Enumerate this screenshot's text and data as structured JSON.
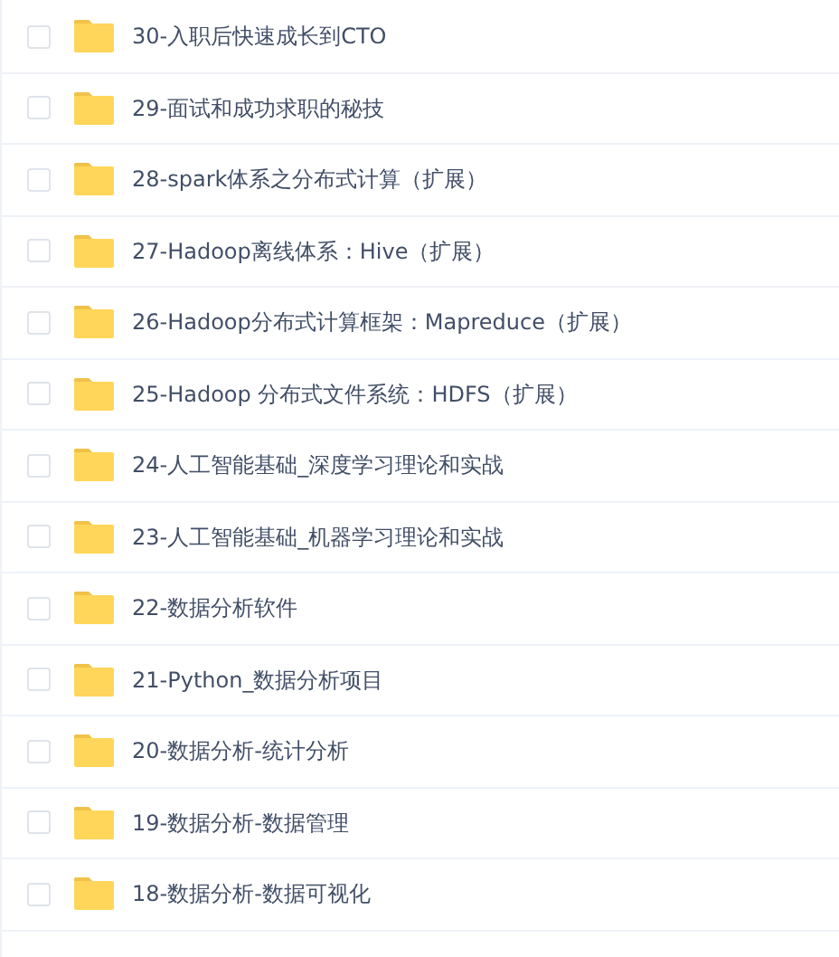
{
  "items": [
    {
      "name": "30-入职后快速成长到CTO",
      "checked": false
    },
    {
      "name": "29-面试和成功求职的秘技",
      "checked": false
    },
    {
      "name": "28-spark体系之分布式计算（扩展）",
      "checked": false
    },
    {
      "name": "27-Hadoop离线体系：Hive（扩展）",
      "checked": false
    },
    {
      "name": "26-Hadoop分布式计算框架：Mapreduce（扩展）",
      "checked": false
    },
    {
      "name": "25-Hadoop 分布式文件系统：HDFS（扩展）",
      "checked": false
    },
    {
      "name": "24-人工智能基础_深度学习理论和实战",
      "checked": false
    },
    {
      "name": "23-人工智能基础_机器学习理论和实战",
      "checked": false
    },
    {
      "name": "22-数据分析软件",
      "checked": false
    },
    {
      "name": "21-Python_数据分析项目",
      "checked": false
    },
    {
      "name": "20-数据分析-统计分析",
      "checked": false
    },
    {
      "name": "19-数据分析-数据管理",
      "checked": false
    },
    {
      "name": "18-数据分析-数据可视化",
      "checked": false
    }
  ]
}
